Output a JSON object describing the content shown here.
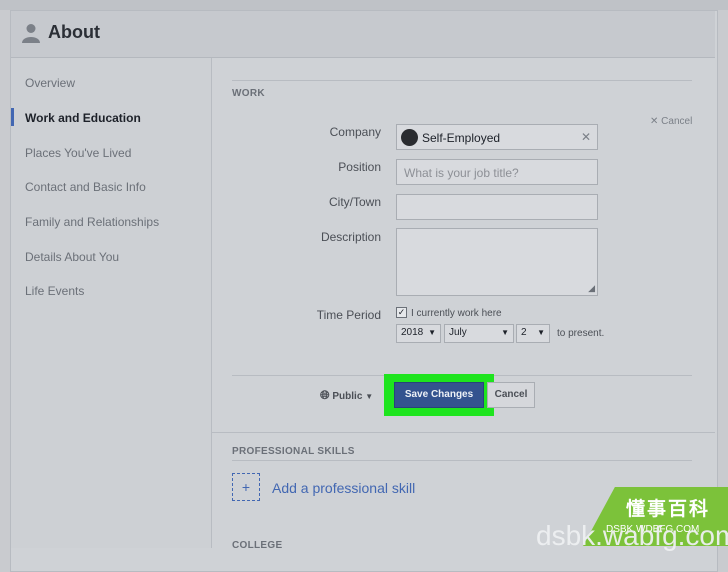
{
  "header": {
    "title": "About"
  },
  "sidebar": {
    "items": [
      {
        "label": "Overview"
      },
      {
        "label": "Work and Education"
      },
      {
        "label": "Places You've Lived"
      },
      {
        "label": "Contact and Basic Info"
      },
      {
        "label": "Family and Relationships"
      },
      {
        "label": "Details About You"
      },
      {
        "label": "Life Events"
      }
    ],
    "active_index": 1
  },
  "work": {
    "section_title": "WORK",
    "cancel_link": "Cancel",
    "company": {
      "label": "Company",
      "value": "Self-Employed"
    },
    "position": {
      "label": "Position",
      "placeholder": "What is your job title?"
    },
    "city": {
      "label": "City/Town",
      "value": ""
    },
    "description": {
      "label": "Description",
      "value": ""
    },
    "time_period": {
      "label": "Time Period",
      "currently_work_label": "I currently work here",
      "currently_work_checked": true,
      "year": "2018",
      "month": "July",
      "day": "2",
      "to_present": "to present."
    },
    "privacy": "Public",
    "save_label": "Save Changes",
    "cancel_label": "Cancel"
  },
  "skills": {
    "section_title": "PROFESSIONAL SKILLS",
    "add_label": "Add a professional skill"
  },
  "college": {
    "section_title": "COLLEGE"
  },
  "watermark": {
    "brand_cn": "懂事百科",
    "url": "DSBK.WDBFG.COM",
    "big": "dsbk.wabfg.com"
  },
  "colors": {
    "accent": "#4267b2",
    "save": "#34538f",
    "highlight": "#1ee41e",
    "wm_green": "#7cc23a"
  }
}
